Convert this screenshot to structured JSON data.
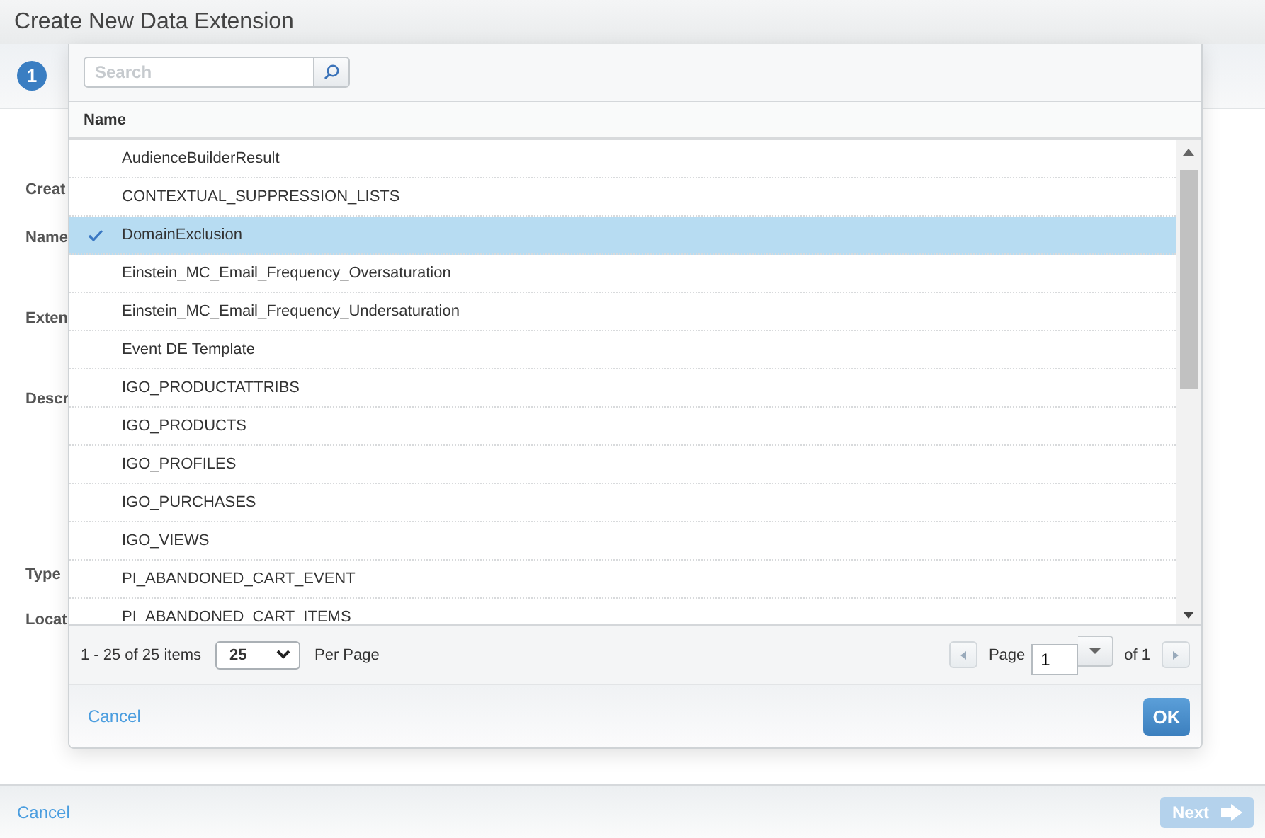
{
  "window": {
    "title": "Create New Data Extension"
  },
  "step": {
    "number": "1"
  },
  "form_labels": [
    "Creat",
    "Name",
    "Exten",
    "Descr",
    "Type",
    "Locat"
  ],
  "footer": {
    "cancel": "Cancel",
    "next": "Next",
    "next_disabled": true
  },
  "dialog": {
    "search": {
      "placeholder": "Search"
    },
    "table": {
      "columns": [
        "Name"
      ],
      "rows": [
        {
          "name": "AudienceBuilderResult",
          "selected": false
        },
        {
          "name": "CONTEXTUAL_SUPPRESSION_LISTS",
          "selected": false
        },
        {
          "name": "DomainExclusion",
          "selected": true
        },
        {
          "name": "Einstein_MC_Email_Frequency_Oversaturation",
          "selected": false
        },
        {
          "name": "Einstein_MC_Email_Frequency_Undersaturation",
          "selected": false
        },
        {
          "name": "Event DE Template",
          "selected": false
        },
        {
          "name": "IGO_PRODUCTATTRIBS",
          "selected": false
        },
        {
          "name": "IGO_PRODUCTS",
          "selected": false
        },
        {
          "name": "IGO_PROFILES",
          "selected": false
        },
        {
          "name": "IGO_PURCHASES",
          "selected": false
        },
        {
          "name": "IGO_VIEWS",
          "selected": false
        },
        {
          "name": "PI_ABANDONED_CART_EVENT",
          "selected": false
        },
        {
          "name": "PI_ABANDONED_CART_ITEMS",
          "selected": false
        }
      ]
    },
    "pager": {
      "range": "1 - 25 of 25 items",
      "page_size": "25",
      "per_page": "Per Page",
      "page_label": "Page",
      "page": "1",
      "of": "of 1"
    },
    "cancel": "Cancel",
    "ok": "OK"
  }
}
